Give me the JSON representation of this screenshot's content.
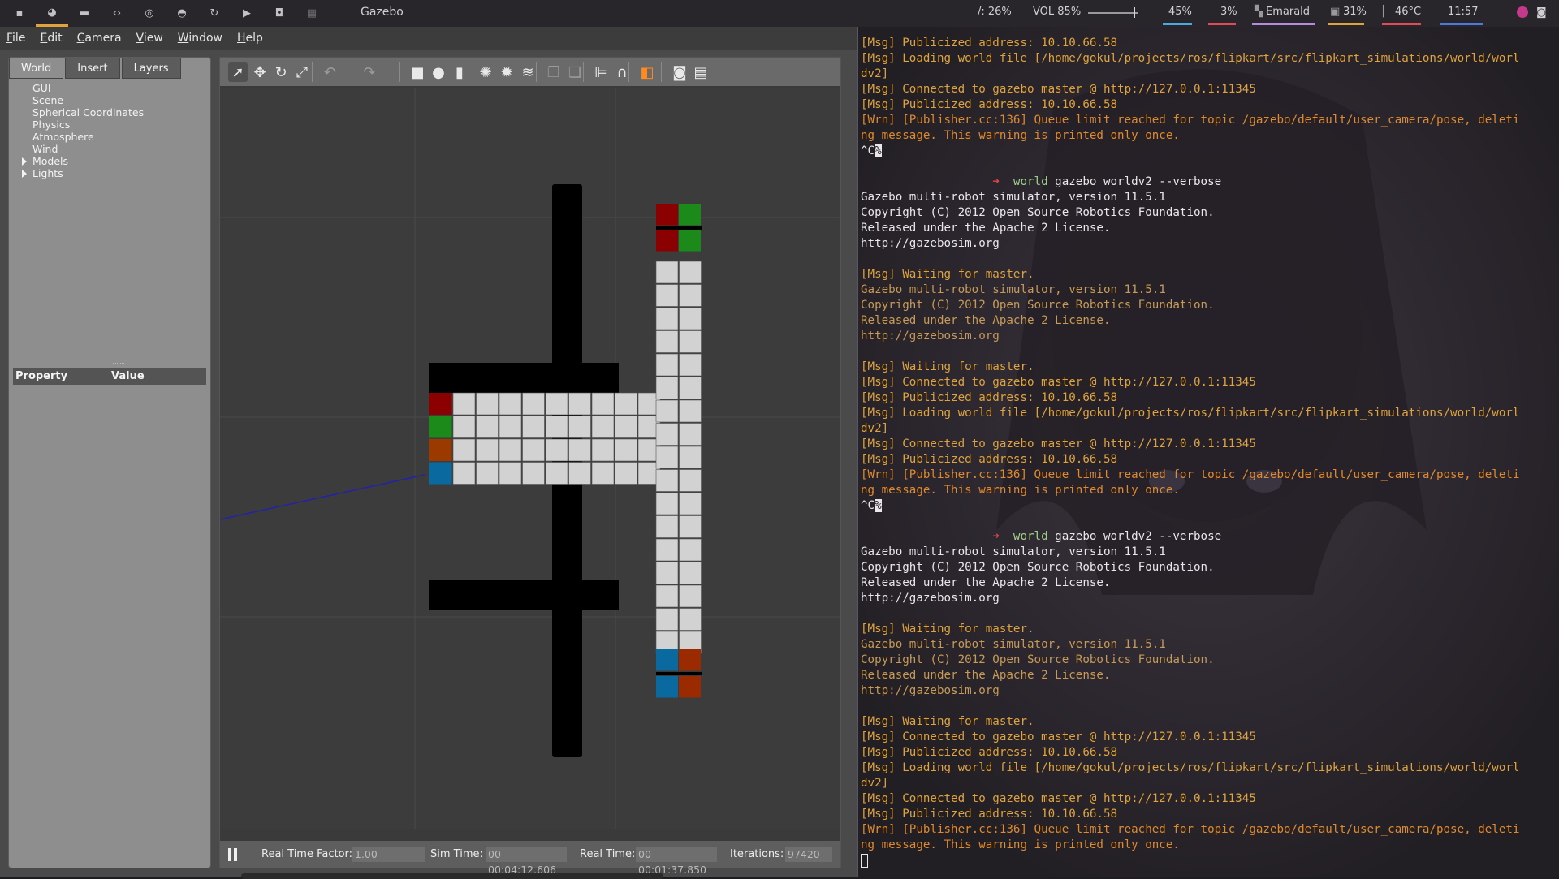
{
  "topbar": {
    "window_title": "Gazebo",
    "workspace_icons": [
      "terminal-icon",
      "firefox-icon",
      "folder-icon",
      "code-icon",
      "chat-icon",
      "gamepad-icon",
      "refresh-icon",
      "youtube-icon",
      "screenshot-icon",
      "grid-icon"
    ],
    "disk": "/: 26%",
    "volume": "VOL 85%",
    "volume_level": 0.85,
    "brightness": "45%",
    "battery": "3%",
    "theme": "Emarald",
    "cpu": "31%",
    "temp": "46°C",
    "clock": "11:57",
    "colors": {
      "brightness": "#4aa9e0",
      "battery": "#e24a5a",
      "theme": "#b58ae0",
      "cpu": "#e0a33c",
      "temp": "#e24a5a",
      "clock": "#4a7ae0"
    }
  },
  "gazebo": {
    "menu": [
      "File",
      "Edit",
      "Camera",
      "View",
      "Window",
      "Help"
    ],
    "tabs": [
      "World",
      "Insert",
      "Layers"
    ],
    "tree": [
      {
        "label": "GUI",
        "expandable": false
      },
      {
        "label": "Scene",
        "expandable": false
      },
      {
        "label": "Spherical Coordinates",
        "expandable": false
      },
      {
        "label": "Physics",
        "expandable": false
      },
      {
        "label": "Atmosphere",
        "expandable": false
      },
      {
        "label": "Wind",
        "expandable": false
      },
      {
        "label": "Models",
        "expandable": true
      },
      {
        "label": "Lights",
        "expandable": true
      }
    ],
    "property_header": {
      "property": "Property",
      "value": "Value"
    },
    "toolbar_icons": [
      "select-arrow-icon",
      "translate-icon",
      "rotate-icon",
      "scale-icon",
      "undo-icon",
      "redo-icon",
      "box-icon",
      "sphere-icon",
      "cylinder-icon",
      "point-light-icon",
      "spot-light-icon",
      "directional-light-icon",
      "copy-icon",
      "paste-icon",
      "align-icon",
      "snap-icon",
      "view-angle-icon",
      "screenshot-icon",
      "log-icon"
    ],
    "bottom": {
      "rtf_label": "Real Time Factor:",
      "rtf": "1.00",
      "sim_label": "Sim Time:",
      "sim": "00 00:04:12.606",
      "real_label": "Real Time:",
      "real": "00 00:01:37.850",
      "iter_label": "Iterations:",
      "iter": "97420"
    }
  },
  "terminal": {
    "lines": [
      {
        "t": "[Msg] Publicized address: 10.10.66.58",
        "c": "l-msg"
      },
      {
        "t": "[Msg] Loading world file [/home/gokul/projects/ros/flipkart/src/flipkart_simulations/world/worl",
        "c": "l-msg"
      },
      {
        "t": "dv2]",
        "c": "l-msg"
      },
      {
        "t": "[Msg] Connected to gazebo master @ http://127.0.0.1:11345",
        "c": "l-msg"
      },
      {
        "t": "[Msg] Publicized address: 10.10.66.58",
        "c": "l-msg"
      },
      {
        "t": "[Wrn] [Publisher.cc:136] Queue limit reached for topic /gazebo/default/user_camera/pose, deleti",
        "c": "l-wrn"
      },
      {
        "t": "ng message. This warning is printed only once.",
        "c": "l-wrn"
      },
      {
        "t": "^C%",
        "c": "caretline"
      },
      {
        "t": "",
        "c": "l-plain"
      },
      {
        "t": "world gazebo worldv2 --verbose",
        "c": "prompt"
      },
      {
        "t": "Gazebo multi-robot simulator, version 11.5.1",
        "c": "l-plain"
      },
      {
        "t": "Copyright (C) 2012 Open Source Robotics Foundation.",
        "c": "l-plain"
      },
      {
        "t": "Released under the Apache 2 License.",
        "c": "l-plain"
      },
      {
        "t": "http://gazebosim.org",
        "c": "l-plain"
      },
      {
        "t": "",
        "c": "l-plain"
      },
      {
        "t": "[Msg] Waiting for master.",
        "c": "l-msg"
      },
      {
        "t": "Gazebo multi-robot simulator, version 11.5.1",
        "c": "l-dim"
      },
      {
        "t": "Copyright (C) 2012 Open Source Robotics Foundation.",
        "c": "l-dim"
      },
      {
        "t": "Released under the Apache 2 License.",
        "c": "l-dim"
      },
      {
        "t": "http://gazebosim.org",
        "c": "l-dim"
      },
      {
        "t": "",
        "c": "l-plain"
      },
      {
        "t": "[Msg] Waiting for master.",
        "c": "l-msg"
      },
      {
        "t": "[Msg] Connected to gazebo master @ http://127.0.0.1:11345",
        "c": "l-msg"
      },
      {
        "t": "[Msg] Publicized address: 10.10.66.58",
        "c": "l-msg"
      },
      {
        "t": "[Msg] Loading world file [/home/gokul/projects/ros/flipkart/src/flipkart_simulations/world/worl",
        "c": "l-msg"
      },
      {
        "t": "dv2]",
        "c": "l-msg"
      },
      {
        "t": "[Msg] Connected to gazebo master @ http://127.0.0.1:11345",
        "c": "l-msg"
      },
      {
        "t": "[Msg] Publicized address: 10.10.66.58",
        "c": "l-msg"
      },
      {
        "t": "[Wrn] [Publisher.cc:136] Queue limit reached for topic /gazebo/default/user_camera/pose, deleti",
        "c": "l-wrn"
      },
      {
        "t": "ng message. This warning is printed only once.",
        "c": "l-wrn"
      },
      {
        "t": "^C%",
        "c": "caretline"
      },
      {
        "t": "",
        "c": "l-plain"
      },
      {
        "t": "world gazebo worldv2 --verbose",
        "c": "prompt"
      },
      {
        "t": "Gazebo multi-robot simulator, version 11.5.1",
        "c": "l-plain"
      },
      {
        "t": "Copyright (C) 2012 Open Source Robotics Foundation.",
        "c": "l-plain"
      },
      {
        "t": "Released under the Apache 2 License.",
        "c": "l-plain"
      },
      {
        "t": "http://gazebosim.org",
        "c": "l-plain"
      },
      {
        "t": "",
        "c": "l-plain"
      },
      {
        "t": "[Msg] Waiting for master.",
        "c": "l-msg"
      },
      {
        "t": "Gazebo multi-robot simulator, version 11.5.1",
        "c": "l-dim"
      },
      {
        "t": "Copyright (C) 2012 Open Source Robotics Foundation.",
        "c": "l-dim"
      },
      {
        "t": "Released under the Apache 2 License.",
        "c": "l-dim"
      },
      {
        "t": "http://gazebosim.org",
        "c": "l-dim"
      },
      {
        "t": "",
        "c": "l-plain"
      },
      {
        "t": "[Msg] Waiting for master.",
        "c": "l-msg"
      },
      {
        "t": "[Msg] Connected to gazebo master @ http://127.0.0.1:11345",
        "c": "l-msg"
      },
      {
        "t": "[Msg] Publicized address: 10.10.66.58",
        "c": "l-msg"
      },
      {
        "t": "[Msg] Loading world file [/home/gokul/projects/ros/flipkart/src/flipkart_simulations/world/worl",
        "c": "l-msg"
      },
      {
        "t": "dv2]",
        "c": "l-msg"
      },
      {
        "t": "[Msg] Connected to gazebo master @ http://127.0.0.1:11345",
        "c": "l-msg"
      },
      {
        "t": "[Msg] Publicized address: 10.10.66.58",
        "c": "l-msg"
      },
      {
        "t": "[Wrn] [Publisher.cc:136] Queue limit reached for topic /gazebo/default/user_camera/pose, deleti",
        "c": "l-wrn"
      },
      {
        "t": "ng message. This warning is printed only once.",
        "c": "l-wrn"
      },
      {
        "t": "",
        "c": "cursorline"
      }
    ]
  }
}
